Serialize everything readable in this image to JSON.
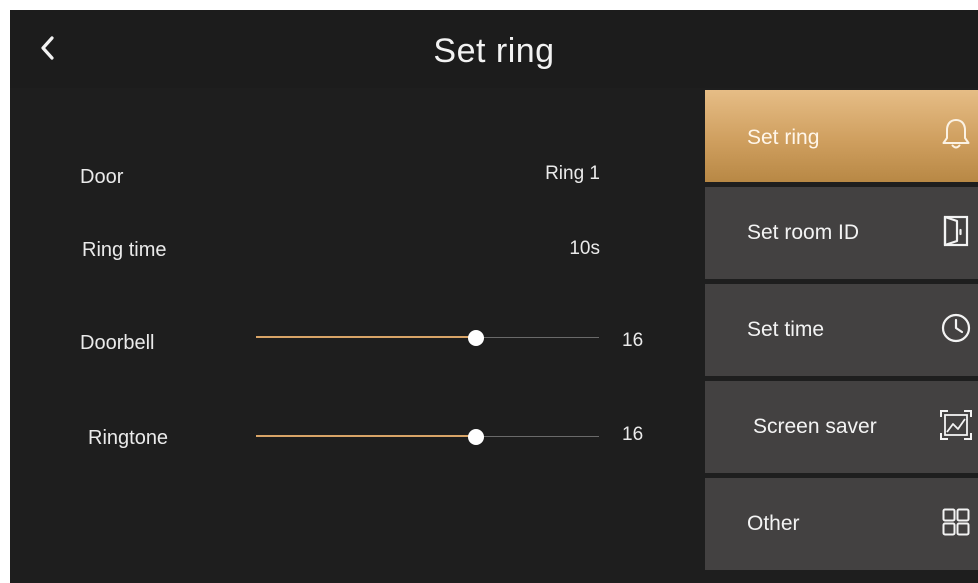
{
  "header": {
    "title": "Set ring",
    "back_icon": "chevron-left-icon"
  },
  "settings": {
    "door": {
      "label": "Door",
      "value": "Ring 1"
    },
    "ring_time": {
      "label": "Ring time",
      "value": "10s"
    },
    "doorbell": {
      "label": "Doorbell",
      "value_text": "16",
      "level_fraction": 0.64
    },
    "ringtone": {
      "label": "Ringtone",
      "value_text": "16",
      "level_fraction": 0.64
    }
  },
  "menu": {
    "items": [
      {
        "label": "Set ring",
        "icon": "bell-icon",
        "active": true
      },
      {
        "label": "Set room ID",
        "icon": "door-icon",
        "active": false
      },
      {
        "label": "Set time",
        "icon": "clock-icon",
        "active": false
      },
      {
        "label": "Screen saver",
        "icon": "screen-saver-icon",
        "active": false
      },
      {
        "label": "Other",
        "icon": "grid-icon",
        "active": false
      }
    ]
  },
  "colors": {
    "background": "#1e1e1e",
    "accent": "#d8a467",
    "menu_item": "#434141",
    "text": "#eaeaea"
  }
}
